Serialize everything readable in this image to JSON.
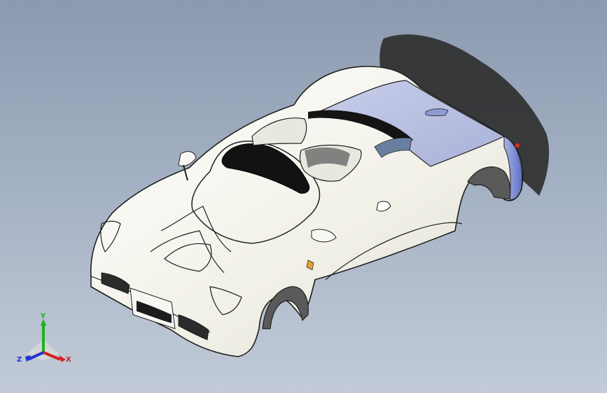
{
  "viewport": {
    "model": "car-body",
    "colors": {
      "background_top": "#8c9ab0",
      "background_bottom": "#c2cbd7",
      "body_fill": "#f3f2ea",
      "body_edge": "#1f1f1f",
      "selected_face": "#b8bfdf",
      "glass": "#111111",
      "shadow": "#2c2c2c",
      "wheel_well": "#5a5a5a",
      "indicator": "#e0a040"
    }
  },
  "triad": {
    "x_label": "X",
    "y_label": "Y",
    "z_label": "Z",
    "x_color": "#d42020",
    "y_color": "#20b020",
    "z_color": "#2030d0"
  }
}
